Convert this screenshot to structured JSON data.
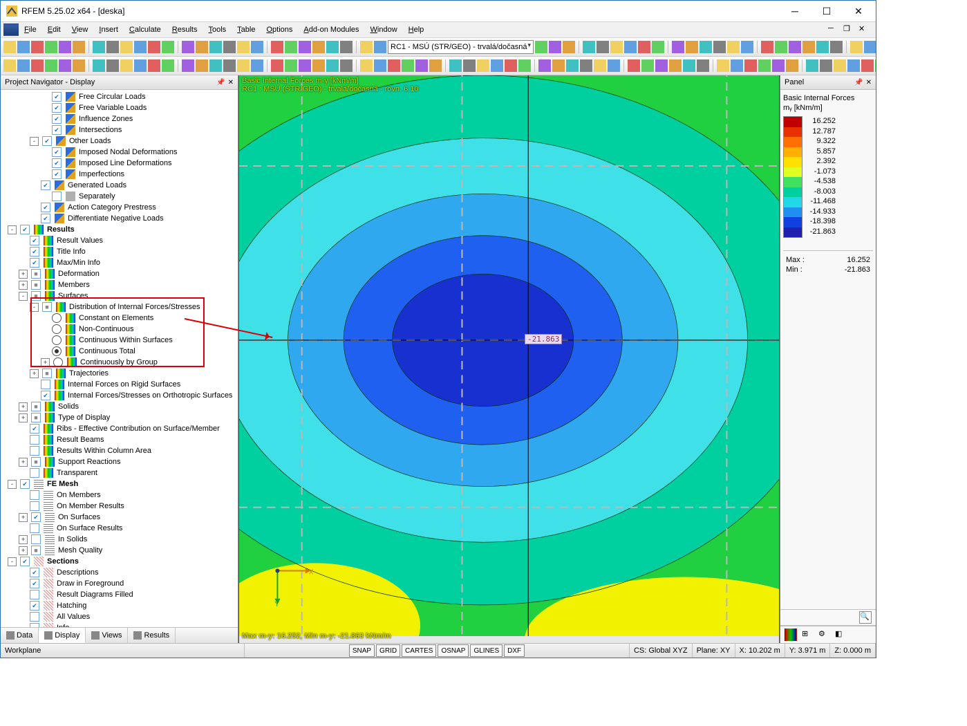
{
  "title": "RFEM 5.25.02 x64 - [deska]",
  "menu": [
    "File",
    "Edit",
    "View",
    "Insert",
    "Calculate",
    "Results",
    "Tools",
    "Table",
    "Options",
    "Add-on Modules",
    "Window",
    "Help"
  ],
  "combo": "RC1 - MSÚ (STR/GEO) - trvalá/dočasná",
  "navigator": {
    "title": "Project Navigator - Display"
  },
  "tree": [
    {
      "d": 3,
      "chk": "c",
      "ico": "arrow",
      "lbl": "Free Circular Loads"
    },
    {
      "d": 3,
      "chk": "c",
      "ico": "arrow",
      "lbl": "Free Variable Loads"
    },
    {
      "d": 3,
      "chk": "c",
      "ico": "arrow",
      "lbl": "Influence Zones"
    },
    {
      "d": 3,
      "chk": "c",
      "ico": "arrow",
      "lbl": "Intersections"
    },
    {
      "d": 2,
      "exp": "-",
      "chk": "c",
      "ico": "arrow",
      "lbl": "Other Loads"
    },
    {
      "d": 3,
      "chk": "c",
      "ico": "arrow",
      "lbl": "Imposed Nodal Deformations"
    },
    {
      "d": 3,
      "chk": "c",
      "ico": "arrow",
      "lbl": "Imposed Line Deformations"
    },
    {
      "d": 3,
      "chk": "c",
      "ico": "arrow",
      "lbl": "Imperfections"
    },
    {
      "d": 2,
      "chk": "c",
      "ico": "arrow",
      "lbl": "Generated Loads"
    },
    {
      "d": 3,
      "chk": "u",
      "ico": "gray",
      "lbl": "Separately"
    },
    {
      "d": 2,
      "chk": "c",
      "ico": "arrow",
      "lbl": "Action Category Prestress"
    },
    {
      "d": 2,
      "chk": "c",
      "ico": "arrow",
      "lbl": "Differentiate Negative Loads"
    },
    {
      "d": 0,
      "exp": "-",
      "chk": "c",
      "ico": "rainbow",
      "lbl": "Results",
      "bold": true
    },
    {
      "d": 1,
      "chk": "c",
      "ico": "rainbow",
      "lbl": "Result Values"
    },
    {
      "d": 1,
      "chk": "c",
      "ico": "rainbow",
      "lbl": "Title Info"
    },
    {
      "d": 1,
      "chk": "c",
      "ico": "rainbow",
      "lbl": "Max/Min Info"
    },
    {
      "d": 1,
      "exp": "+",
      "chk": "i",
      "ico": "rainbow",
      "lbl": "Deformation"
    },
    {
      "d": 1,
      "exp": "+",
      "chk": "i",
      "ico": "rainbow",
      "lbl": "Members"
    },
    {
      "d": 1,
      "exp": "-",
      "chk": "i",
      "ico": "rainbow",
      "lbl": "Surfaces"
    },
    {
      "d": 2,
      "exp": "-",
      "chk": "i",
      "ico": "rainbow",
      "lbl": "Distribution of Internal Forces/Stresses",
      "hlstart": true
    },
    {
      "d": 3,
      "rd": "off",
      "ico": "rainbow",
      "lbl": "Constant on Elements"
    },
    {
      "d": 3,
      "rd": "off",
      "ico": "rainbow",
      "lbl": "Non-Continuous"
    },
    {
      "d": 3,
      "rd": "off",
      "ico": "rainbow",
      "lbl": "Continuous Within Surfaces"
    },
    {
      "d": 3,
      "rd": "on",
      "ico": "rainbow",
      "lbl": "Continuous Total"
    },
    {
      "d": 3,
      "exp": "+",
      "rd": "off",
      "ico": "rainbow",
      "lbl": "Continuously by Group",
      "hlend": true
    },
    {
      "d": 2,
      "exp": "+",
      "chk": "i",
      "ico": "rainbow",
      "lbl": "Trajectories"
    },
    {
      "d": 2,
      "chk": "u",
      "ico": "rainbow",
      "lbl": "Internal Forces on Rigid Surfaces"
    },
    {
      "d": 2,
      "chk": "c",
      "ico": "rainbow",
      "lbl": "Internal Forces/Stresses on Orthotropic Surfaces"
    },
    {
      "d": 1,
      "exp": "+",
      "chk": "i",
      "ico": "rainbow",
      "lbl": "Solids"
    },
    {
      "d": 1,
      "exp": "+",
      "chk": "i",
      "ico": "rainbow",
      "lbl": "Type of Display"
    },
    {
      "d": 1,
      "chk": "c",
      "ico": "rainbow",
      "lbl": "Ribs - Effective Contribution on Surface/Member"
    },
    {
      "d": 1,
      "chk": "u",
      "ico": "rainbow",
      "lbl": "Result Beams"
    },
    {
      "d": 1,
      "chk": "u",
      "ico": "rainbow",
      "lbl": "Results Within Column Area"
    },
    {
      "d": 1,
      "exp": "+",
      "chk": "i",
      "ico": "rainbow",
      "lbl": "Support Reactions"
    },
    {
      "d": 1,
      "chk": "u",
      "ico": "rainbow",
      "lbl": "Transparent"
    },
    {
      "d": 0,
      "exp": "-",
      "chk": "c",
      "ico": "mesh",
      "lbl": "FE Mesh",
      "bold": true
    },
    {
      "d": 1,
      "chk": "u",
      "ico": "mesh",
      "lbl": "On Members"
    },
    {
      "d": 1,
      "chk": "u",
      "ico": "mesh",
      "lbl": "On Member Results"
    },
    {
      "d": 1,
      "exp": "+",
      "chk": "c",
      "ico": "mesh",
      "lbl": "On Surfaces"
    },
    {
      "d": 1,
      "chk": "u",
      "ico": "mesh",
      "lbl": "On Surface Results"
    },
    {
      "d": 1,
      "exp": "+",
      "chk": "u",
      "ico": "mesh",
      "lbl": "In Solids"
    },
    {
      "d": 1,
      "exp": "+",
      "chk": "i",
      "ico": "mesh",
      "lbl": "Mesh Quality"
    },
    {
      "d": 0,
      "exp": "-",
      "chk": "c",
      "ico": "hatch",
      "lbl": "Sections",
      "bold": true
    },
    {
      "d": 1,
      "chk": "c",
      "ico": "hatch",
      "lbl": "Descriptions"
    },
    {
      "d": 1,
      "chk": "c",
      "ico": "hatch",
      "lbl": "Draw in Foreground"
    },
    {
      "d": 1,
      "chk": "u",
      "ico": "hatch",
      "lbl": "Result Diagrams Filled"
    },
    {
      "d": 1,
      "chk": "c",
      "ico": "hatch",
      "lbl": "Hatching"
    },
    {
      "d": 1,
      "chk": "u",
      "ico": "hatch",
      "lbl": "All Values"
    },
    {
      "d": 1,
      "chk": "u",
      "ico": "hatch",
      "lbl": "Info"
    }
  ],
  "navtabs": [
    {
      "l": "Data"
    },
    {
      "l": "Display",
      "active": true
    },
    {
      "l": "Views"
    },
    {
      "l": "Results"
    }
  ],
  "overlay": {
    "line1": "Basic Internal Forces m-y [kNm/m]",
    "line2": "RC1 : MSÚ (STR/GEO) - trvalá/dočasná - rovn. 6.10",
    "bottom": "Max m-y: 16.252, Min m-y: -21.863 kNm/m",
    "value": "-21.863"
  },
  "panel": {
    "title": "Panel",
    "heading": "Basic Internal Forces",
    "units": "mᵧ [kNm/m]",
    "scale": [
      {
        "c": "#c00000",
        "v": "16.252"
      },
      {
        "c": "#e83000",
        "v": "12.787"
      },
      {
        "c": "#ff7000",
        "v": "9.322"
      },
      {
        "c": "#ffb000",
        "v": "5.857"
      },
      {
        "c": "#ffe000",
        "v": "2.392"
      },
      {
        "c": "#e0ff20",
        "v": "-1.073"
      },
      {
        "c": "#40e060",
        "v": "-4.538"
      },
      {
        "c": "#00d0a0",
        "v": "-8.003"
      },
      {
        "c": "#20d8e8",
        "v": "-11.468"
      },
      {
        "c": "#2090f0",
        "v": "-14.933"
      },
      {
        "c": "#1040e0",
        "v": "-18.398"
      },
      {
        "c": "#2020b0",
        "v": "-21.863"
      }
    ],
    "max": {
      "l": "Max :",
      "v": "16.252"
    },
    "min": {
      "l": "Min :",
      "v": "-21.863"
    }
  },
  "status": {
    "left": "Workplane",
    "snaps": [
      "SNAP",
      "GRID",
      "CARTES",
      "OSNAP",
      "GLINES",
      "DXF"
    ],
    "cs": "CS: Global XYZ",
    "plane": "Plane: XY",
    "x": "X: 10.202 m",
    "y": "Y: 3.971 m",
    "z": "Z: 0.000 m"
  }
}
